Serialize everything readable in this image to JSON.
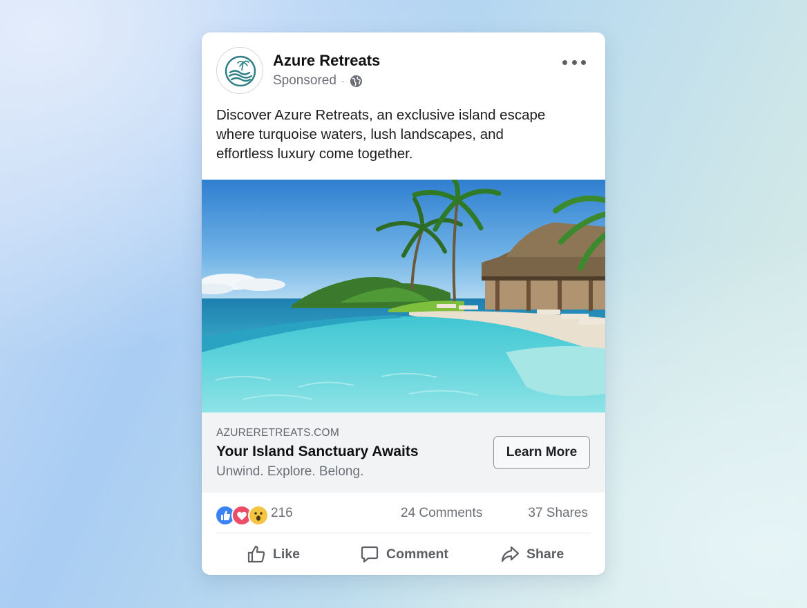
{
  "post": {
    "page_name": "Azure Retreats",
    "sponsored_label": "Sponsored",
    "separator": "·",
    "caption": "Discover Azure Retreats, an exclusive island escape where turquoise waters, lush landscapes, and effortless luxury come together.",
    "icons": [
      "azure-retreats-logo",
      "more-options-icon",
      "globe-icon"
    ]
  },
  "link_preview": {
    "domain": "AZURERETREATS.COM",
    "headline": "Your Island Sanctuary Awaits",
    "description": "Unwind. Explore. Belong.",
    "cta_label": "Learn More"
  },
  "engagement": {
    "reaction_icons": [
      "like-reaction-icon",
      "love-reaction-icon",
      "wow-reaction-icon"
    ],
    "reaction_count": "216",
    "comments": "24 Comments",
    "shares": "37 Shares"
  },
  "actions": {
    "like_label": "Like",
    "comment_label": "Comment",
    "share_label": "Share"
  },
  "colors": {
    "like": "#3b82f6",
    "love": "#ec4c66",
    "wow": "#f4c542",
    "brand_teal": "#2f7f86"
  }
}
